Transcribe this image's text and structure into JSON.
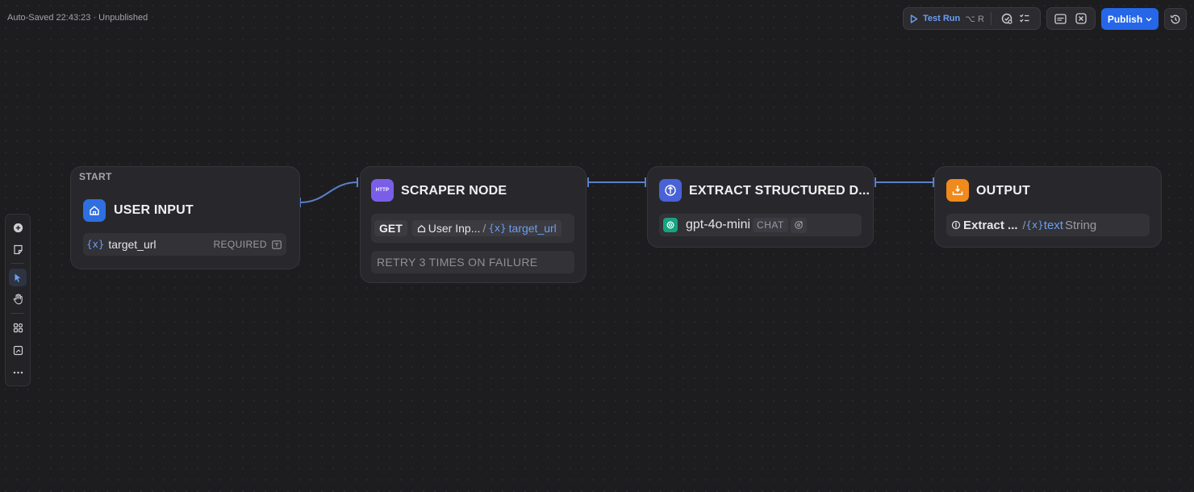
{
  "header": {
    "status_text": "Auto-Saved 22:43:23 · Unpublished",
    "test_run_label": "Test Run",
    "test_run_shortcut": "⌥ R",
    "publish_label": "Publish",
    "env_icon_label": "ENV"
  },
  "nodes": {
    "start": {
      "tag": "START",
      "title": "USER INPUT",
      "field_name": "target_url",
      "required_label": "REQUIRED"
    },
    "scraper": {
      "icon_label": "HTTP",
      "title": "SCRAPER NODE",
      "method": "GET",
      "source_node": "User Inp...",
      "path_separator": "/",
      "variable": "target_url",
      "retry_label": "RETRY 3 TIMES ON FAILURE"
    },
    "extract": {
      "title": "EXTRACT STRUCTURED D...",
      "model": "gpt-4o-mini",
      "mode_badge": "CHAT"
    },
    "output": {
      "title": "OUTPUT",
      "source_node": "Extract ...",
      "path_separator": "/",
      "variable": "text",
      "type": "String"
    }
  },
  "colors": {
    "accent": "#2567e8",
    "variable": "#6b9ef0",
    "user_input_icon": "#2f6fe0",
    "http_icon": "#7b5ee8",
    "extract_icon": "#4a62d6",
    "output_icon": "#f08a1c",
    "openai_icon": "#16a37f"
  }
}
